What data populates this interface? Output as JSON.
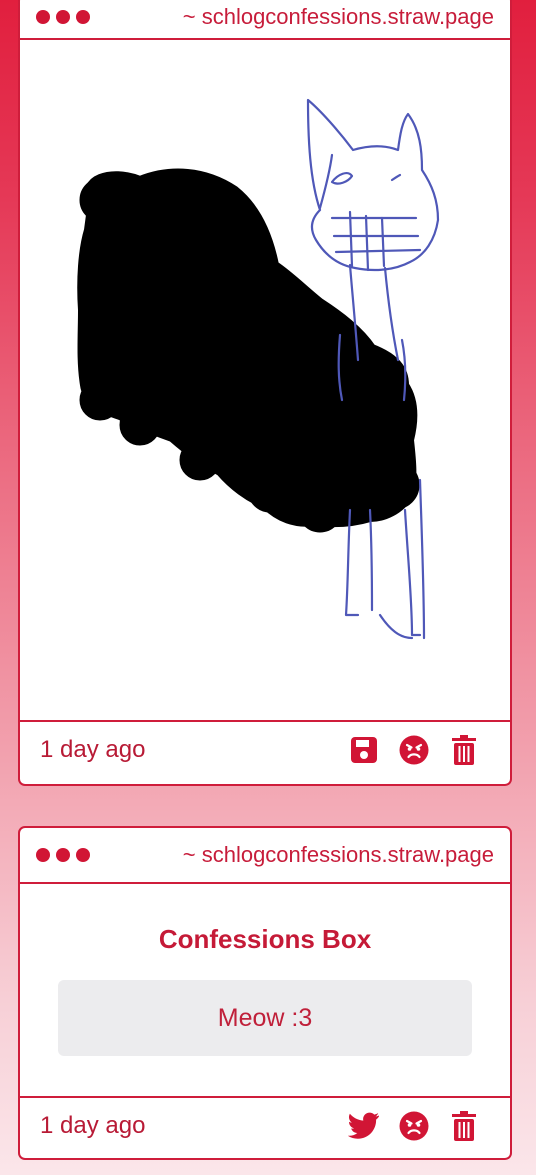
{
  "colors": {
    "accent": "#cf1d3b",
    "dot": "#d11535",
    "text_red": "#c71c3a",
    "message_bg": "#ececee",
    "drawing_blue": "#4f58b8",
    "drawing_black": "#000000"
  },
  "cards": [
    {
      "url": "~ schlogconfessions.straw.page",
      "time": "1 day ago",
      "actions": [
        "save-icon",
        "angry-face-icon",
        "trash-icon"
      ]
    },
    {
      "url": "~ schlogconfessions.straw.page",
      "title": "Confessions Box",
      "message": "Meow :3",
      "time": "1 day ago",
      "actions": [
        "twitter-icon",
        "angry-face-icon",
        "trash-icon"
      ]
    }
  ]
}
